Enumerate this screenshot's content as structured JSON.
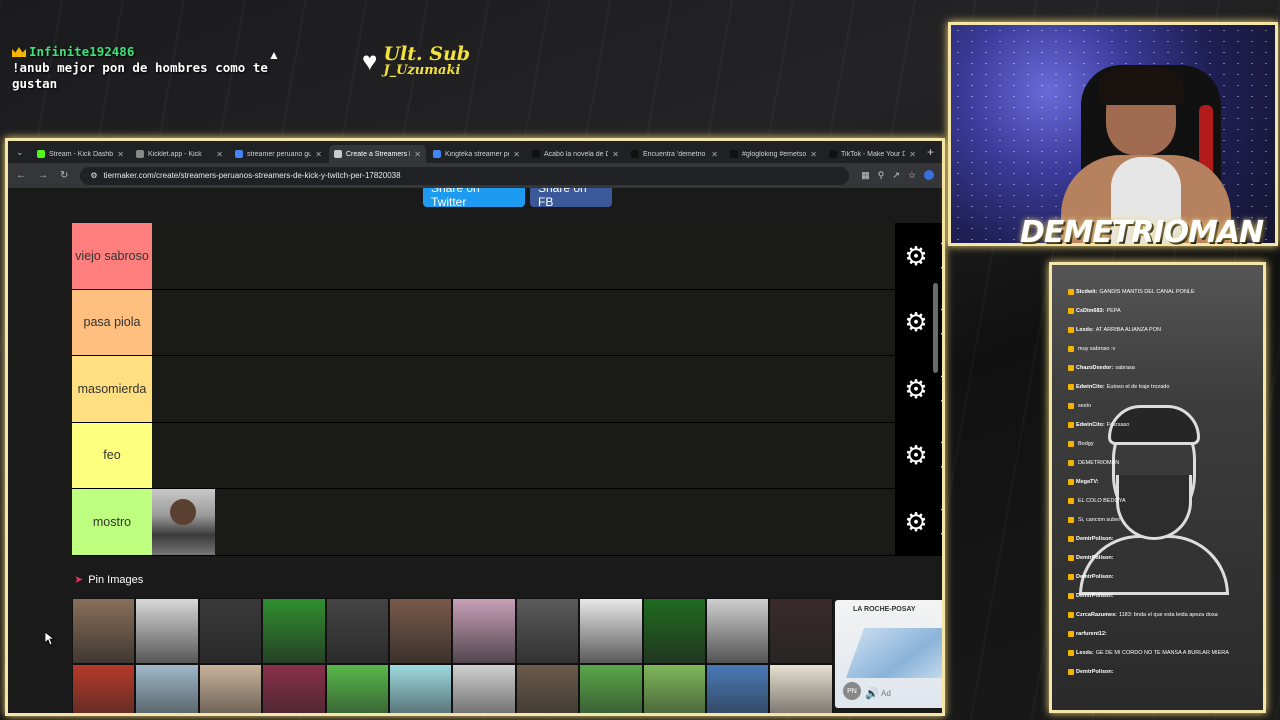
{
  "overlay_chat": {
    "user": "Infinite192486",
    "message": "!anub mejor pon de hombres como te gustan"
  },
  "last_sub": {
    "title": "Ult. Sub",
    "name": "J_Uzumaki"
  },
  "browser": {
    "tabs": [
      {
        "title": "Stream - Kick Dashb",
        "color": "#53fc18",
        "active": false
      },
      {
        "title": "Kicklet.app - Kick",
        "color": "#888888",
        "active": false
      },
      {
        "title": "streamer peruano gu",
        "color": "#4285f4",
        "active": false
      },
      {
        "title": "Create a Streamers P",
        "color": "#cccccc",
        "active": true
      },
      {
        "title": "Kingteka streamer pe",
        "color": "#4285f4",
        "active": false
      },
      {
        "title": "Acabó la novela de D",
        "color": "#111111",
        "active": false
      },
      {
        "title": "Encuentra 'demetrio",
        "color": "#111111",
        "active": false
      },
      {
        "title": "#glogloking #emetso",
        "color": "#111111",
        "active": false
      },
      {
        "title": "TikTok - Make Your D",
        "color": "#111111",
        "active": false
      }
    ],
    "url": "tiermaker.com/create/streamers-peruanos-streamers-de-kick-y-twitch-per-17820038"
  },
  "page": {
    "share_twitter": "Share on Twitter",
    "share_fb": "Share on FB",
    "tiers": [
      {
        "label": "viejo sabroso",
        "color": "#ff7f7f"
      },
      {
        "label": "pasa piola",
        "color": "#ffbf7f"
      },
      {
        "label": "masomierda",
        "color": "#ffdf7f"
      },
      {
        "label": "feo",
        "color": "#ffff7f"
      },
      {
        "label": "mostro",
        "color": "#bfff7f"
      }
    ],
    "pin_images_label": "Pin Images",
    "ad": {
      "brand": "LA ROCHE-POSAY",
      "badge": "PN",
      "label": "Ad"
    }
  },
  "cam": {
    "name": "DEMETRIOMAN"
  },
  "right_chat": {
    "messages": [
      {
        "user": "Stcdwit:",
        "text": "GANDIS MANTIS DEL CANAL PONLE"
      },
      {
        "user": "CsDim683:",
        "text": "PEPA"
      },
      {
        "user": "Lexds:",
        "text": "AT ARRIBA ALIANZA PON"
      },
      {
        "user": "",
        "text": "muy sabroso :v"
      },
      {
        "user": "ChazoDxedor:",
        "text": "sabrasa"
      },
      {
        "user": "EdwinCito:",
        "text": "Eutoso el de traje trozado"
      },
      {
        "user": "",
        "text": "sexto"
      },
      {
        "user": "EdwinCito:",
        "text": "Frozsaso"
      },
      {
        "user": "",
        "text": "Bodgy"
      },
      {
        "user": "",
        "text": "DEMETRIOMAN"
      },
      {
        "user": "MegaTV:",
        "text": ""
      },
      {
        "user": "",
        "text": "EL COLO BEDOYA"
      },
      {
        "user": "",
        "text": "Si, cancion suber"
      },
      {
        "user": "DemtrPolison:",
        "text": ""
      },
      {
        "user": "DemtrPolison:",
        "text": ""
      },
      {
        "user": "DemtrPolison:",
        "text": ""
      },
      {
        "user": "DemtrPolison:",
        "text": ""
      },
      {
        "user": "CzrcaRazumes:",
        "text": "1183: bnda el que esta leida apeza dosa"
      },
      {
        "user": "rarfurent12:",
        "text": ""
      },
      {
        "user": "Lexds:",
        "text": "GE DE MI CORDO NO TE MANSA A BURLAR MIERA"
      },
      {
        "user": "DemtrPolison:",
        "text": ""
      }
    ]
  }
}
